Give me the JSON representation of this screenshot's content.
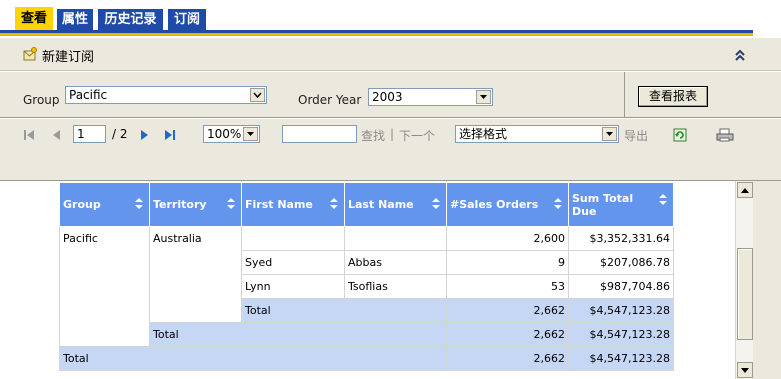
{
  "tabs": [
    {
      "label": "查看",
      "active": true
    },
    {
      "label": "属性",
      "active": false
    },
    {
      "label": "历史记录",
      "active": false
    },
    {
      "label": "订阅",
      "active": false
    }
  ],
  "subscription": {
    "label": "新建订阅"
  },
  "params": {
    "group_label": "Group",
    "group_value": "Pacific",
    "year_label": "Order Year",
    "year_value": "2003",
    "view_report_button": "查看报表"
  },
  "toolbar": {
    "page_current": "1",
    "page_total": "/ 2",
    "zoom": "100%",
    "find_value": "",
    "find_label": "查找",
    "separator": "|",
    "next_label": "下一个",
    "format_value": "选择格式",
    "export_label": "导出"
  },
  "report": {
    "headers": [
      "Group",
      "Territory",
      "First Name",
      "Last Name",
      "#Sales Orders",
      "Sum Total Due"
    ],
    "group": "Pacific",
    "territory": "Australia",
    "rows": [
      {
        "first": "",
        "last": "",
        "orders": "2,600",
        "total": "$3,352,331.64"
      },
      {
        "first": "Syed",
        "last": "Abbas",
        "orders": "9",
        "total": "$207,086.78"
      },
      {
        "first": "Lynn",
        "last": "Tsoflias",
        "orders": "53",
        "total": "$987,704.86"
      }
    ],
    "territory_total": {
      "label": "Total",
      "orders": "2,662",
      "total": "$4,547,123.28"
    },
    "group_total": {
      "label": "Total",
      "orders": "2,662",
      "total": "$4,547,123.28"
    },
    "grand_total": {
      "label": "Total",
      "orders": "2,662",
      "total": "$4,547,123.28"
    }
  },
  "colors": {
    "tab_active": "#ffd400",
    "tab_inactive": "#1f4aa8",
    "header_bg": "#6495ed",
    "subtotal_bg": "#c6d7f5",
    "panel_bg": "#ebe8dd"
  }
}
